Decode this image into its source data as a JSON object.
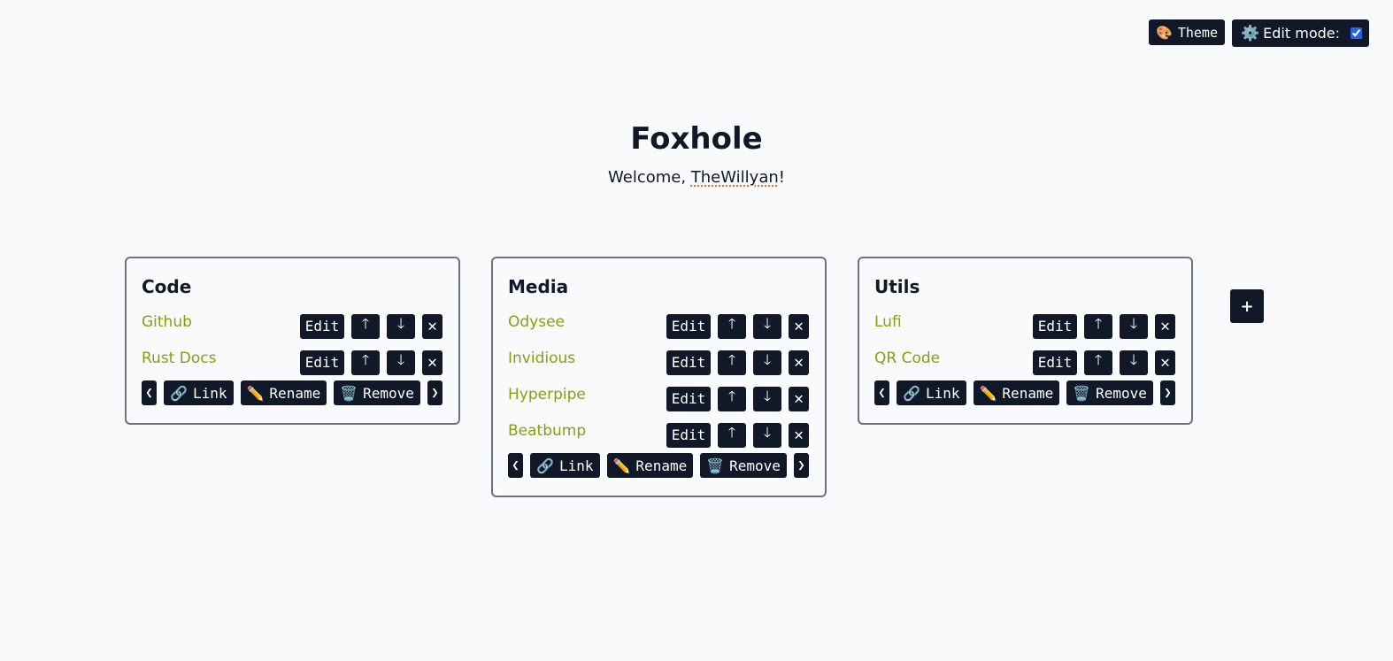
{
  "top": {
    "theme_icon": "🎨",
    "theme_label": "Theme",
    "edit_icon": "⚙️",
    "edit_label": "Edit mode:",
    "edit_checked": true
  },
  "header": {
    "title": "Foxhole",
    "welcome_prefix": "Welcome, ",
    "username": "TheWillyan",
    "welcome_suffix": "!"
  },
  "link_actions": {
    "edit": "Edit",
    "up": "🡑",
    "down": "🡓",
    "remove": "✕"
  },
  "footer": {
    "prev": "❮",
    "link_icon": "🔗",
    "link": "Link",
    "rename_icon": "✏️",
    "rename": "Rename",
    "remove_icon": "🗑️",
    "remove": "Remove",
    "next": "❯"
  },
  "add_button": "+",
  "groups": [
    {
      "title": "Code",
      "links": [
        "Github",
        "Rust Docs"
      ]
    },
    {
      "title": "Media",
      "links": [
        "Odysee",
        "Invidious",
        "Hyperpipe",
        "Beatbump"
      ]
    },
    {
      "title": "Utils",
      "links": [
        "Lufi",
        "QR Code"
      ]
    }
  ],
  "colors": {
    "background": "#f9fafb",
    "button": "#111827",
    "link": "#84a013",
    "border": "#6b7280"
  }
}
